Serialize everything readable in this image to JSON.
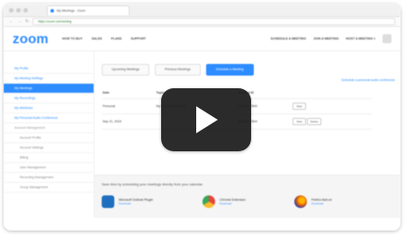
{
  "browser": {
    "tab_title": "My Meetings - Zoom",
    "url": "https://zoom.us/meeting"
  },
  "nav": {
    "logo": "zoom",
    "links": [
      "HOW TO BUY",
      "SALES",
      "PLANS",
      "SUPPORT"
    ],
    "right_links": [
      "SCHEDULE A MEETING",
      "JOIN A MEETING",
      "HOST A MEETING ▾"
    ]
  },
  "sidebar": {
    "items": [
      {
        "label": "My Profile",
        "type": "item"
      },
      {
        "label": "My Meeting Settings",
        "type": "item"
      },
      {
        "label": "My Meetings",
        "type": "active"
      },
      {
        "label": "My Recordings",
        "type": "item"
      },
      {
        "label": "My Webinars",
        "type": "item"
      },
      {
        "label": "My Personal Audio Conference",
        "type": "item"
      },
      {
        "label": "Account Management",
        "type": "group"
      },
      {
        "label": "Account Profile",
        "type": "sub"
      },
      {
        "label": "Account Settings",
        "type": "sub"
      },
      {
        "label": "Billing",
        "type": "sub"
      },
      {
        "label": "User Management",
        "type": "sub"
      },
      {
        "label": "Recording Management",
        "type": "sub"
      },
      {
        "label": "Group Management",
        "type": "sub"
      }
    ]
  },
  "tabs": {
    "upcoming": "Upcoming Meetings",
    "previous": "Previous Meetings",
    "schedule": "Schedule a Meeting"
  },
  "personal_link": "Schedule a personal audio conference",
  "table": {
    "headers": [
      "Date",
      "Topic",
      "Meeting ID",
      ""
    ],
    "rows": [
      {
        "date": "Personal",
        "topic": "My Personal Meeting",
        "id": "525 425 7849",
        "actions": [
          "Start"
        ]
      },
      {
        "date": "Sep 21, 2015",
        "topic": "",
        "id": "628 255 7844",
        "actions": [
          "Start",
          "Delete"
        ]
      }
    ]
  },
  "promo": {
    "text": "Save time by scheduling your meetings directly from your calendar.",
    "plugins": [
      {
        "name": "Microsoft Outlook Plugin",
        "link": "Download",
        "color": "#1f6fbf"
      },
      {
        "name": "Chrome Extension",
        "link": "Download",
        "color": "#e8453c"
      },
      {
        "name": "Firefox Add-on",
        "link": "Download",
        "color": "#e66000"
      }
    ]
  },
  "colors": {
    "accent": "#2d8cff",
    "play_bg": "#1b1b1b"
  },
  "overlay": {
    "icon": "play-icon"
  }
}
